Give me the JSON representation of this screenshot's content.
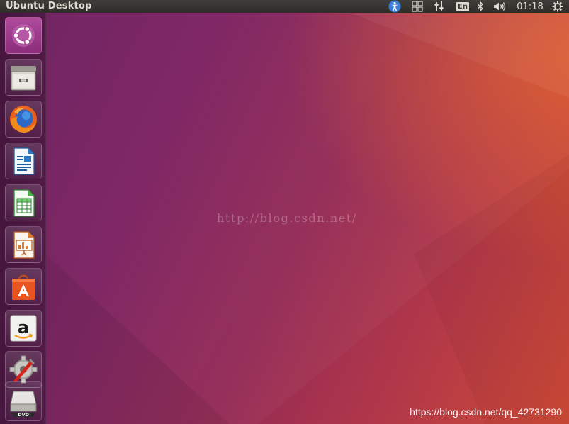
{
  "top_panel": {
    "title": "Ubuntu Desktop",
    "indicators": {
      "accessibility": "accessibility-icon",
      "workspaces": "workspace-switcher-icon",
      "network": "network-transfer-icon",
      "keyboard_layout": "En",
      "bluetooth": "bluetooth-icon",
      "sound": "volume-icon",
      "clock": "01:18",
      "session": "gear-icon"
    }
  },
  "launcher": {
    "items": [
      {
        "name": "Search your computer",
        "icon": "ubuntu-logo-icon"
      },
      {
        "name": "Files",
        "icon": "file-cabinet-icon"
      },
      {
        "name": "Firefox Web Browser",
        "icon": "firefox-icon"
      },
      {
        "name": "LibreOffice Writer",
        "icon": "writer-document-icon"
      },
      {
        "name": "LibreOffice Calc",
        "icon": "calc-spreadsheet-icon"
      },
      {
        "name": "LibreOffice Impress",
        "icon": "impress-presentation-icon"
      },
      {
        "name": "Ubuntu Software",
        "icon": "software-bag-icon"
      },
      {
        "name": "Amazon",
        "icon": "amazon-icon"
      },
      {
        "name": "System Settings",
        "icon": "settings-wrench-icon"
      },
      {
        "name": "DVD",
        "icon": "dvd-drive-icon"
      }
    ]
  },
  "desktop": {
    "watermark_center": "http://blog.csdn.net/",
    "watermark_corner": "https://blog.csdn.net/qq_42731290"
  },
  "colors": {
    "panel": "#3c3b37",
    "wallpaper_left": "#6d1e5e",
    "wallpaper_right": "#cf4a36"
  }
}
